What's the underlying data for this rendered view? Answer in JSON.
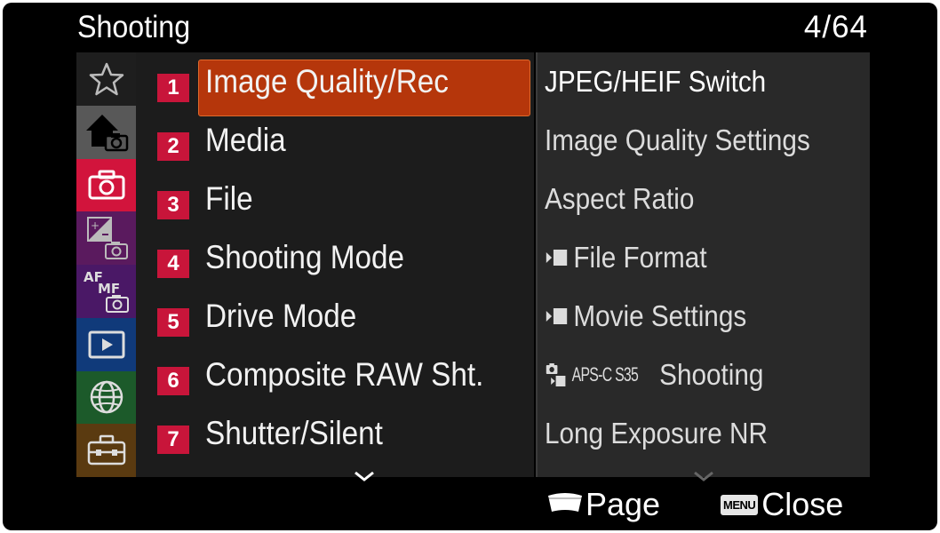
{
  "header": {
    "title": "Shooting",
    "page": "4/64"
  },
  "tabs": [
    {
      "icon": "star-icon",
      "color": "#1e1e1e"
    },
    {
      "icon": "home-camera-icon",
      "color": "#585858"
    },
    {
      "icon": "camera-icon",
      "color": "#d2143c"
    },
    {
      "icon": "exposure-camera-icon",
      "color": "#5a1a5e"
    },
    {
      "icon": "af-mf-camera-icon",
      "color": "#4a1866"
    },
    {
      "icon": "playback-icon",
      "color": "#103a7a"
    },
    {
      "icon": "globe-icon",
      "color": "#1c5a2a"
    },
    {
      "icon": "toolbox-icon",
      "color": "#5a3a10"
    }
  ],
  "menu": {
    "selected_index": 0,
    "items": [
      {
        "number": "1",
        "label": "Image Quality/Rec"
      },
      {
        "number": "2",
        "label": "Media"
      },
      {
        "number": "3",
        "label": "File"
      },
      {
        "number": "4",
        "label": "Shooting Mode"
      },
      {
        "number": "5",
        "label": "Drive Mode"
      },
      {
        "number": "6",
        "label": "Composite RAW Sht."
      },
      {
        "number": "7",
        "label": "Shutter/Silent"
      }
    ]
  },
  "submenu": {
    "items": [
      {
        "label": "JPEG/HEIF Switch",
        "prefix": ""
      },
      {
        "label": "Image Quality Settings",
        "prefix": ""
      },
      {
        "label": "Aspect Ratio",
        "prefix": ""
      },
      {
        "label": "File Format",
        "prefix": "movie"
      },
      {
        "label": "Movie Settings",
        "prefix": "movie"
      },
      {
        "label": "Shooting",
        "prefix": "aps",
        "tag": "APS-C S35"
      },
      {
        "label": "Long Exposure NR",
        "prefix": ""
      }
    ]
  },
  "footer": {
    "page_label": "Page",
    "menu_badge": "MENU",
    "close_label": "Close"
  },
  "colors": {
    "accent": "#b5360b",
    "number_badge": "#c8153a"
  }
}
